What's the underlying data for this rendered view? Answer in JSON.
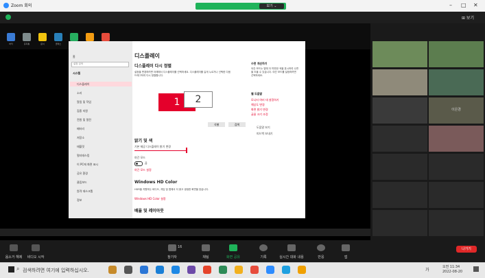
{
  "titlebar": {
    "app_title": "Zoom 회의",
    "share_menu_label": "보기 ⌄",
    "minimize": "–",
    "maximize": "□",
    "close": "✕"
  },
  "zoombar": {
    "view_label": "⊞ 보기"
  },
  "settings": {
    "home": "홈",
    "search_placeholder": "설정 검색",
    "system": "시스템",
    "nav": [
      "디스플레이",
      "소리",
      "알림 및 작업",
      "집중 지원",
      "전원 및 절전",
      "배터리",
      "저장소",
      "태블릿",
      "멀티태스킹",
      "이 PC에 화면 표시",
      "공유 환경",
      "클립보드",
      "원격 데스크톱",
      "정보"
    ],
    "page_title": "디스플레이",
    "rearrange_title": "디스플레이 다시 정렬",
    "rearrange_desc": "설정을 변경하려면 아래에서 디스플레이를 선택하세요. 디스플레이를 길게 누르거나 선택한 다음 드래그하여 다시 정렬합니다.",
    "monitor1": "1",
    "monitor2": "2",
    "identify_btn": "식별",
    "detect_btn": "검색",
    "brightness_title": "밝기 및 색",
    "brightness_label": "기본 제공 디스플레이 밝기 변경",
    "night_label": "야간 모드",
    "night_state": "끔",
    "night_link": "야간 모드 설정",
    "hdr_title": "Windows HD Color",
    "hdr_desc": "HDR을 지원하는 비디오, 게임 및 앱에서 더 밝고 생생한 화면을 얻습니다.",
    "hdr_link": "Windows HD Color 설정",
    "scale_title": "배율 및 레이아웃",
    "side_sleep_title": "수면 개선하기",
    "side_sleep_desc": "야간 모드는 밤에 더 따뜻한 색을 표시하여 수면을 도울 수 있습니다. 야간 모드를 설정하려면 선택하세요.",
    "side_help_title": "웹 도움말",
    "side_links": [
      "모니터 여러 대 설정하기",
      "해상도 변경",
      "화면 밝기 변경",
      "글꼴 크기 조정"
    ],
    "side_help": "도움말 보기",
    "side_feedback": "피드백 보내기"
  },
  "desktop_icons": [
    {
      "label": "바닥",
      "color": "#3a7bd5"
    },
    {
      "label": "휴지통",
      "color": "#7f8c8d"
    },
    {
      "label": "문서",
      "color": "#f1c40f"
    },
    {
      "label": "클래스",
      "color": "#2980b9"
    },
    {
      "label": "Chrome",
      "color": "#27ae60"
    },
    {
      "label": "Zoom",
      "color": "#f39c12"
    },
    {
      "label": "PDF",
      "color": "#e74c3c"
    }
  ],
  "gallery": {
    "names": [
      "",
      "",
      "",
      "",
      "",
      "이은경",
      "",
      "",
      "",
      "",
      "",
      "",
      "",
      "",
      ""
    ]
  },
  "controls": {
    "audio": "음소거 해제",
    "video": "비디오 시작",
    "participants": "참가자",
    "participant_count": "16",
    "chat": "채팅",
    "share": "화면 공유",
    "record": "기록",
    "caption": "실시간 대화 내용",
    "reactions": "반응",
    "apps": "앱",
    "end": "나가기"
  },
  "taskbar": {
    "search_placeholder": "검색하려면 여기에 입력하십시오.",
    "time": "오전 11:34",
    "date": "2022-08-20",
    "lang": "가"
  }
}
